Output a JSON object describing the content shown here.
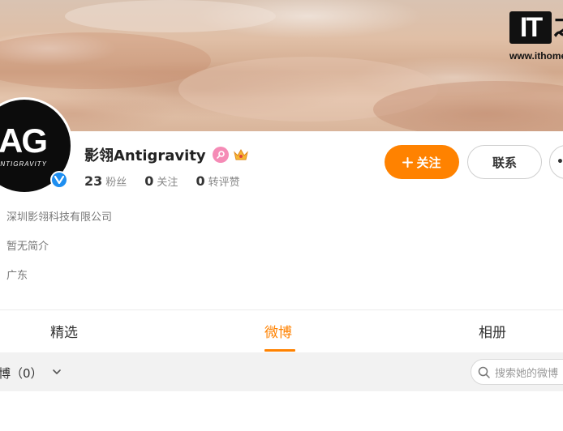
{
  "watermark": {
    "logo": "IT",
    "char": "之",
    "url": "www.ithome"
  },
  "avatar": {
    "mark": "AG",
    "subtitle": "ANTIGRAVITY"
  },
  "profile": {
    "name": "影翎Antigravity",
    "stats": [
      {
        "value": "23",
        "label": "粉丝"
      },
      {
        "value": "0",
        "label": "关注"
      },
      {
        "value": "0",
        "label": "转评赞"
      }
    ]
  },
  "actions": {
    "follow": "关注",
    "contact": "联系"
  },
  "info": {
    "company": "深圳影翎科技有限公司",
    "bio": "暂无简介",
    "location": "广东"
  },
  "tabs": [
    {
      "label": "精选",
      "active": false
    },
    {
      "label": "微博",
      "active": true
    },
    {
      "label": "相册",
      "active": false
    }
  ],
  "filter": {
    "label": "博（0）",
    "search_placeholder": "搜索她的微博"
  },
  "colors": {
    "accent": "#ff8200",
    "verified": "#1e8ef0",
    "badge": "#f58bb6"
  },
  "icons": [
    "verified-icon",
    "pink-badge-icon",
    "crown-icon",
    "plus-icon",
    "more-icon",
    "chevron-down-icon",
    "search-icon"
  ]
}
